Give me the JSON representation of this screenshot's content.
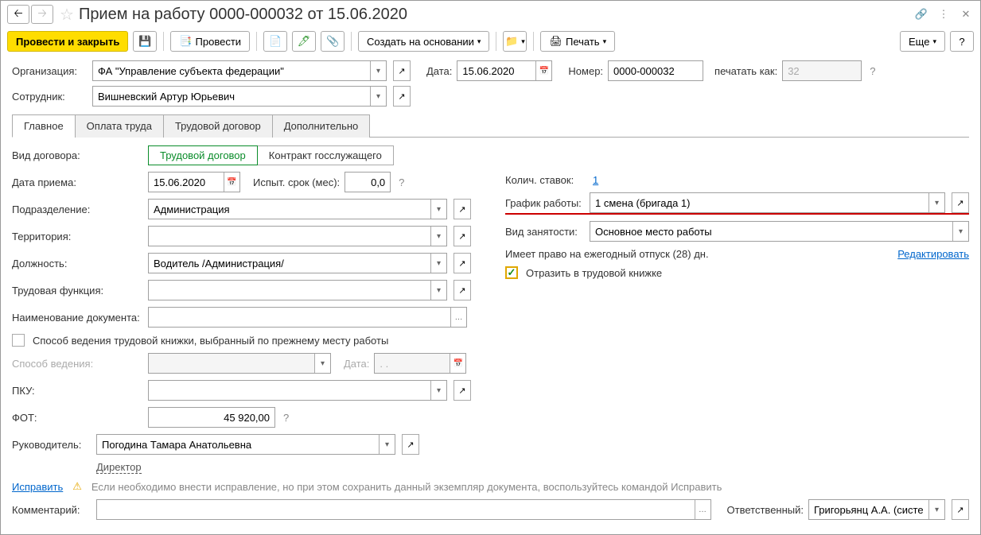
{
  "header": {
    "title": "Прием на работу 0000-000032 от 15.06.2020"
  },
  "toolbar": {
    "submit_close": "Провести и закрыть",
    "submit": "Провести",
    "create_based": "Создать на основании",
    "print": "Печать",
    "more": "Еще"
  },
  "top": {
    "org_label": "Организация:",
    "org_value": "ФА \"Управление субъекта федерации\"",
    "date_label": "Дата:",
    "date_value": "15.06.2020",
    "number_label": "Номер:",
    "number_value": "0000-000032",
    "print_as_label": "печатать как:",
    "print_as_value": "32",
    "employee_label": "Сотрудник:",
    "employee_value": "Вишневский Артур Юрьевич"
  },
  "tabs": {
    "t1": "Главное",
    "t2": "Оплата труда",
    "t3": "Трудовой договор",
    "t4": "Дополнительно"
  },
  "main": {
    "contract_type_label": "Вид договора:",
    "contract_type_1": "Трудовой договор",
    "contract_type_2": "Контракт госслужащего",
    "hire_date_label": "Дата приема:",
    "hire_date_value": "15.06.2020",
    "probation_label": "Испыт. срок (мес):",
    "probation_value": "0,0",
    "dept_label": "Подразделение:",
    "dept_value": "Администрация",
    "territory_label": "Территория:",
    "territory_value": "",
    "position_label": "Должность:",
    "position_value": "Водитель /Администрация/",
    "func_label": "Трудовая функция:",
    "func_value": "",
    "docname_label": "Наименование документа:",
    "docname_value": "",
    "prev_method_label": "Способ ведения трудовой книжки, выбранный по прежнему месту работы",
    "method_label": "Способ ведения:",
    "method_value": "",
    "method_date_label": "Дата:",
    "method_date_value": ". .",
    "pku_label": "ПКУ:",
    "pku_value": "",
    "fot_label": "ФОТ:",
    "fot_value": "45 920,00",
    "rates_label": "Колич. ставок:",
    "rates_value": "1",
    "schedule_label": "График работы:",
    "schedule_value": "1 смена (бригада 1)",
    "employment_label": "Вид занятости:",
    "employment_value": "Основное место работы",
    "vacation_text": "Имеет право на ежегодный отпуск (28) дн.",
    "vacation_edit": "Редактировать",
    "reflect_label": "Отразить в трудовой книжке"
  },
  "footer": {
    "manager_label": "Руководитель:",
    "manager_value": "Погодина Тамара Анатольевна",
    "manager_pos": "Директор",
    "fix_link": "Исправить",
    "fix_note": "Если необходимо внести исправление, но при этом сохранить данный экземпляр документа, воспользуйтесь командой Исправить",
    "comment_label": "Комментарий:",
    "comment_value": "",
    "responsible_label": "Ответственный:",
    "responsible_value": "Григорьянц А.А. (системн"
  },
  "help_char": "?"
}
